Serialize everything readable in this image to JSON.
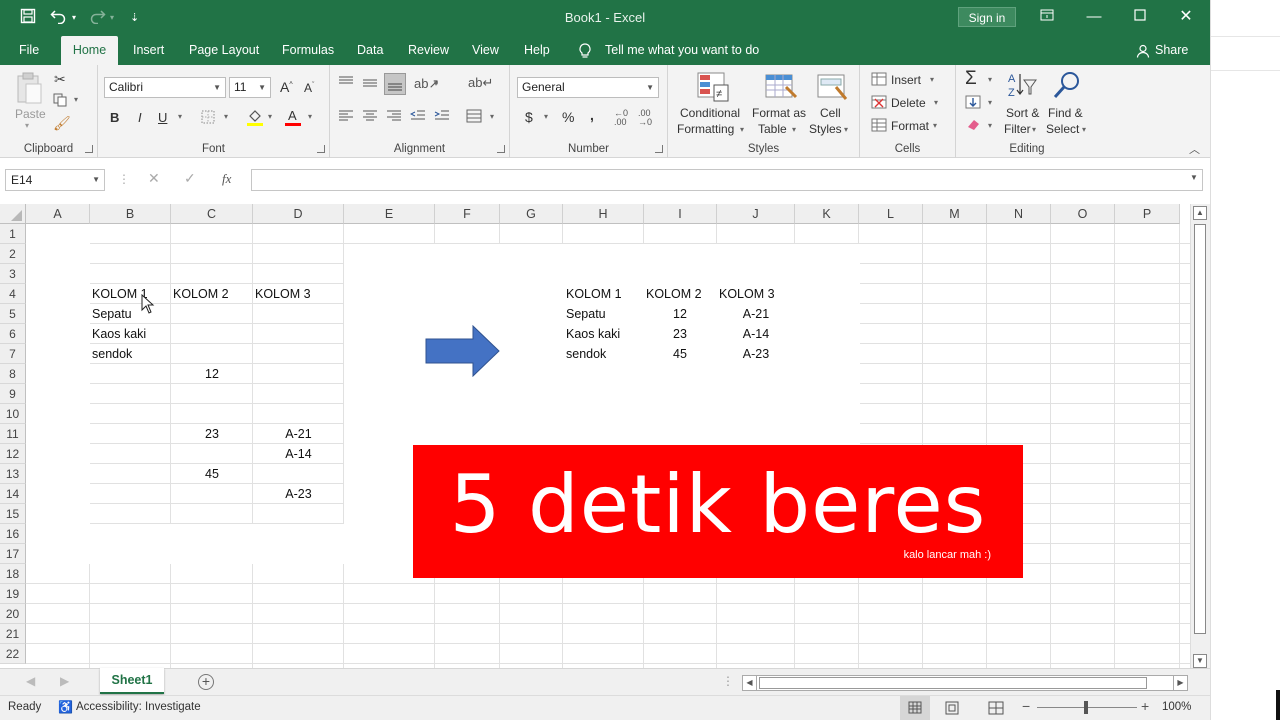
{
  "app": {
    "title": "Book1  -  Excel",
    "signin": "Sign in"
  },
  "tabs": [
    "File",
    "Home",
    "Insert",
    "Page Layout",
    "Formulas",
    "Data",
    "Review",
    "View",
    "Help"
  ],
  "tell_me": "Tell me what you want to do",
  "share": "Share",
  "ribbon": {
    "clipboard": {
      "label": "Clipboard",
      "paste": "Paste"
    },
    "font": {
      "label": "Font",
      "name": "Calibri",
      "size": "11",
      "bold": "B",
      "italic": "I",
      "underline": "U"
    },
    "alignment": {
      "label": "Alignment"
    },
    "number": {
      "label": "Number",
      "format": "General",
      "currency": "$",
      "percent": "%",
      "comma": ","
    },
    "styles": {
      "label": "Styles",
      "conditional": "Conditional",
      "conditional2": "Formatting",
      "format_table": "Format as",
      "format_table2": "Table",
      "cell_styles": "Cell",
      "cell_styles2": "Styles"
    },
    "cells": {
      "label": "Cells",
      "insert": "Insert",
      "delete": "Delete",
      "format": "Format"
    },
    "editing": {
      "label": "Editing",
      "sort": "Sort &",
      "sort2": "Filter",
      "find": "Find &",
      "find2": "Select"
    }
  },
  "namebox": "E14",
  "columns": [
    "A",
    "B",
    "C",
    "D",
    "E",
    "F",
    "G",
    "H",
    "I",
    "J",
    "K",
    "L",
    "M",
    "N",
    "O",
    "P"
  ],
  "rows": [
    "1",
    "2",
    "3",
    "4",
    "5",
    "6",
    "7",
    "8",
    "9",
    "10",
    "11",
    "12",
    "13",
    "14",
    "15",
    "16",
    "17",
    "18",
    "19",
    "20",
    "21",
    "22"
  ],
  "left_table": {
    "headers": [
      "KOLOM 1",
      "KOLOM 2",
      "KOLOM 3"
    ],
    "col1": [
      "Sepatu",
      "Kaos kaki",
      "sendok"
    ],
    "col2": [
      "12",
      "23",
      "45"
    ],
    "col3": [
      "A-21",
      "A-14",
      "A-23"
    ]
  },
  "right_table": {
    "headers": [
      "KOLOM 1",
      "KOLOM 2",
      "KOLOM 3"
    ],
    "rows": [
      [
        "Sepatu",
        "12",
        "A-21"
      ],
      [
        "Kaos kaki",
        "23",
        "A-14"
      ],
      [
        "sendok",
        "45",
        "A-23"
      ]
    ]
  },
  "banner": {
    "main": "5 detik beres",
    "sub": "kalo lancar mah :)",
    "color": "#ff0000"
  },
  "arrow_color": "#4472c4",
  "sheet_tab": "Sheet1",
  "status": {
    "ready": "Ready",
    "accessibility": "Accessibility: Investigate",
    "zoom": "100%"
  }
}
